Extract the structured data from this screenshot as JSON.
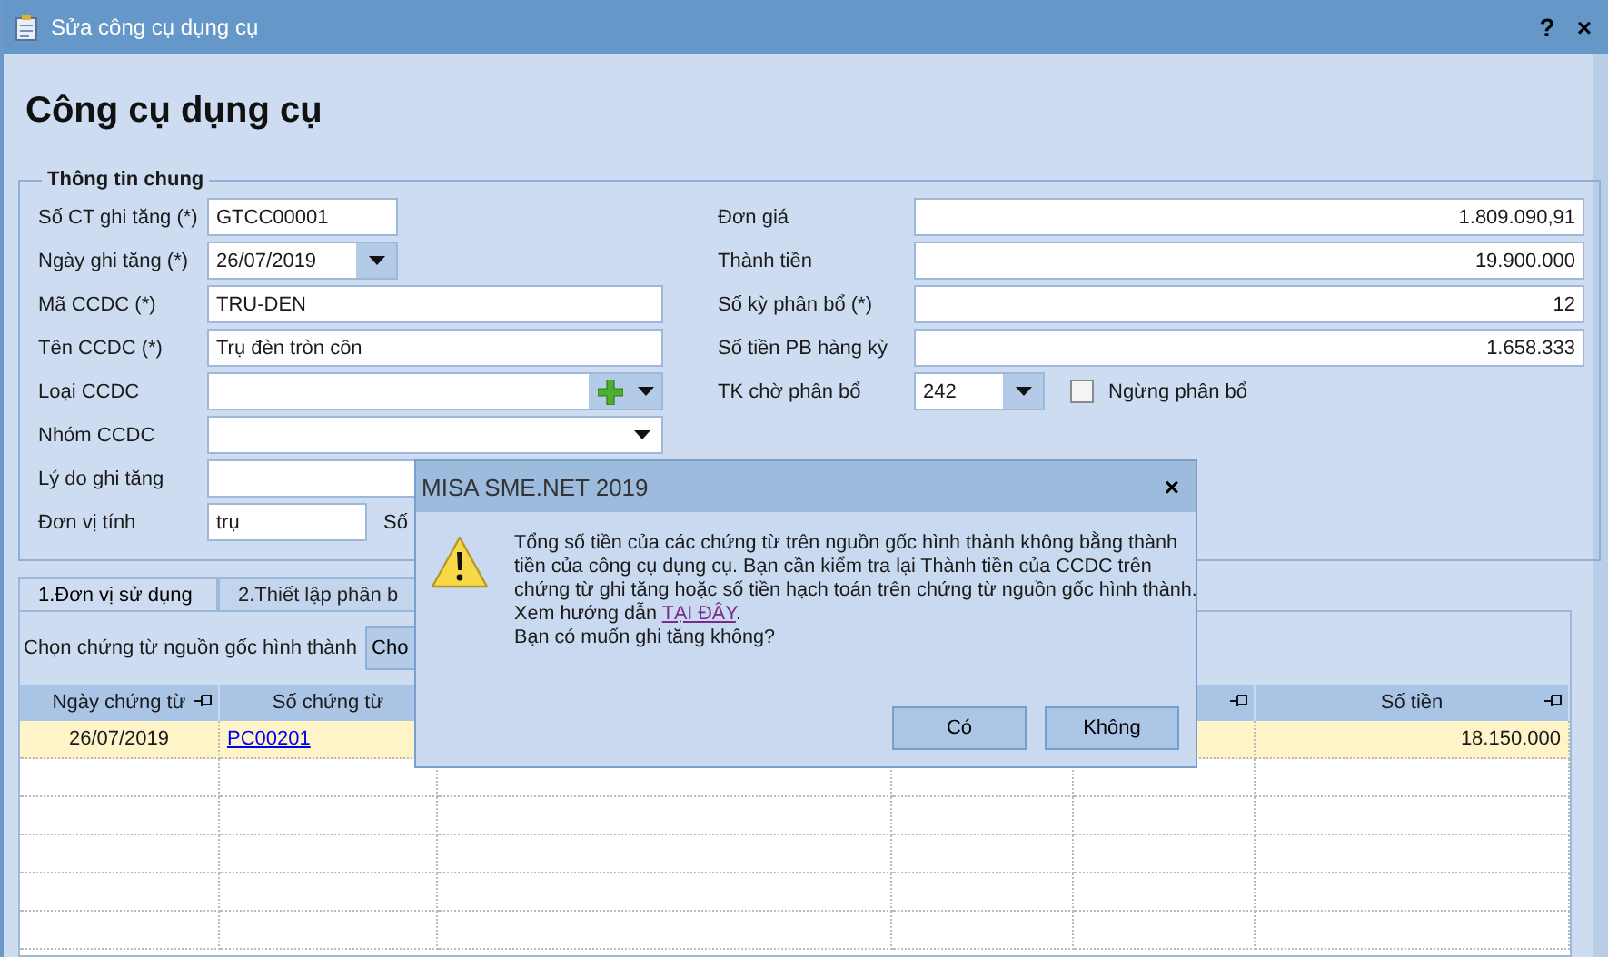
{
  "window": {
    "title": "Sửa công cụ dụng cụ",
    "help": "?",
    "close": "×"
  },
  "heading": "Công cụ dụng cụ",
  "general": {
    "legend": "Thông tin chung",
    "left_fields": [
      {
        "kind": "text",
        "label": "Số CT ghi tăng (*)",
        "value": "GTCC00001"
      },
      {
        "kind": "date",
        "label": "Ngày ghi tăng (*)",
        "value": "26/07/2019"
      },
      {
        "kind": "wide",
        "label": "Mã CCDC (*)",
        "value": "TRU-DEN"
      },
      {
        "kind": "wide",
        "label": "Tên CCDC (*)",
        "value": "Trụ đèn tròn côn"
      },
      {
        "kind": "combo_add",
        "label": "Loại CCDC"
      },
      {
        "kind": "combo",
        "label": "Nhóm CCDC"
      },
      {
        "kind": "wide",
        "label": "Lý do ghi tăng"
      },
      {
        "kind": "unit",
        "label": "Đơn vị tính",
        "value": "trụ",
        "extra_label": "Số"
      }
    ],
    "right_fields": [
      {
        "kind": "number",
        "label": "Đơn giá",
        "value": "1.809.090,91"
      },
      {
        "kind": "number",
        "label": "Thành tiền",
        "value": "19.900.000"
      },
      {
        "kind": "number",
        "label": "Số kỳ phân bổ (*)",
        "value": "12"
      },
      {
        "kind": "number",
        "label": "Số tiền PB hàng kỳ",
        "value": "1.658.333"
      },
      {
        "kind": "account",
        "label": "TK chờ phân bổ",
        "value": "242"
      }
    ],
    "stop": {
      "label": "Ngừng phân bổ",
      "checked": false
    }
  },
  "tabs": [
    {
      "label": "1.Đơn vị sử dụng",
      "selected": true
    },
    {
      "label": "2.Thiết lập phân b",
      "selected": false
    }
  ],
  "source": {
    "label": "Chọn chứng từ nguồn gốc hình thành",
    "button": "Cho"
  },
  "table": {
    "columns": [
      {
        "label": "Ngày chứng từ",
        "pinned": true
      },
      {
        "label": "Số chứng từ",
        "pinned": false
      },
      {},
      {},
      {
        "pinned": true
      },
      {
        "label": "Số tiền",
        "pinned": true
      }
    ],
    "rows": [
      {
        "date": "26/07/2019",
        "voucher": "PC00201",
        "amount": "18.150.000",
        "selected": true
      }
    ]
  },
  "dialog": {
    "title": "MISA SME.NET 2019",
    "close": "×",
    "lines": [
      "Tổng số tiền của các chứng từ trên nguồn gốc hình thành không bằng thành",
      "tiền của công cụ dụng cụ. Bạn cần kiểm tra lại Thành tiền của CCDC trên",
      "chứng từ ghi tăng hoặc số tiền hạch toán trên chứng từ nguồn gốc hình thành."
    ],
    "guide": "Xem hướng dẫn ",
    "link": "TẠI ĐÂY",
    "guide_end": ".",
    "question": "Bạn có muốn ghi tăng không?",
    "buttons": [
      "Có",
      "Không"
    ]
  }
}
